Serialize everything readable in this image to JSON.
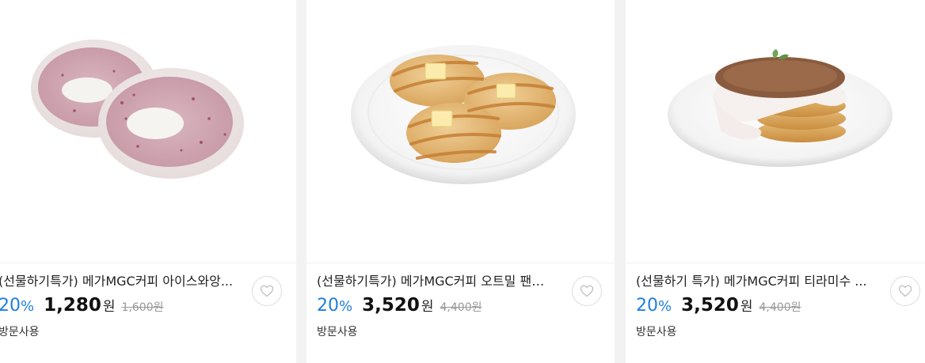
{
  "products": [
    {
      "title": "(선물하기특가) 메가MGC커피 아이스와앙...",
      "discount": "20",
      "discount_unit": "%",
      "price": "1,280",
      "price_unit": "원",
      "original_price": "1,600원",
      "usage": "방문사용",
      "image": "ice-rice-cake-image",
      "wishlist_icon": "heart-icon"
    },
    {
      "title": "(선물하기특가) 메가MGC커피 오트밀 팬케...",
      "discount": "20",
      "discount_unit": "%",
      "price": "3,520",
      "price_unit": "원",
      "original_price": "4,400원",
      "usage": "방문사용",
      "image": "oatmeal-pancake-image",
      "wishlist_icon": "heart-icon"
    },
    {
      "title": "(선물하기 특가) 메가MGC커피 티라미수 ...",
      "discount": "20",
      "discount_unit": "%",
      "price": "3,520",
      "price_unit": "원",
      "original_price": "4,400원",
      "usage": "방문사용",
      "image": "tiramisu-pancake-image",
      "wishlist_icon": "heart-icon"
    }
  ],
  "colors": {
    "discount": "#1f7fe0",
    "price": "#111111",
    "original_price": "#999999"
  }
}
